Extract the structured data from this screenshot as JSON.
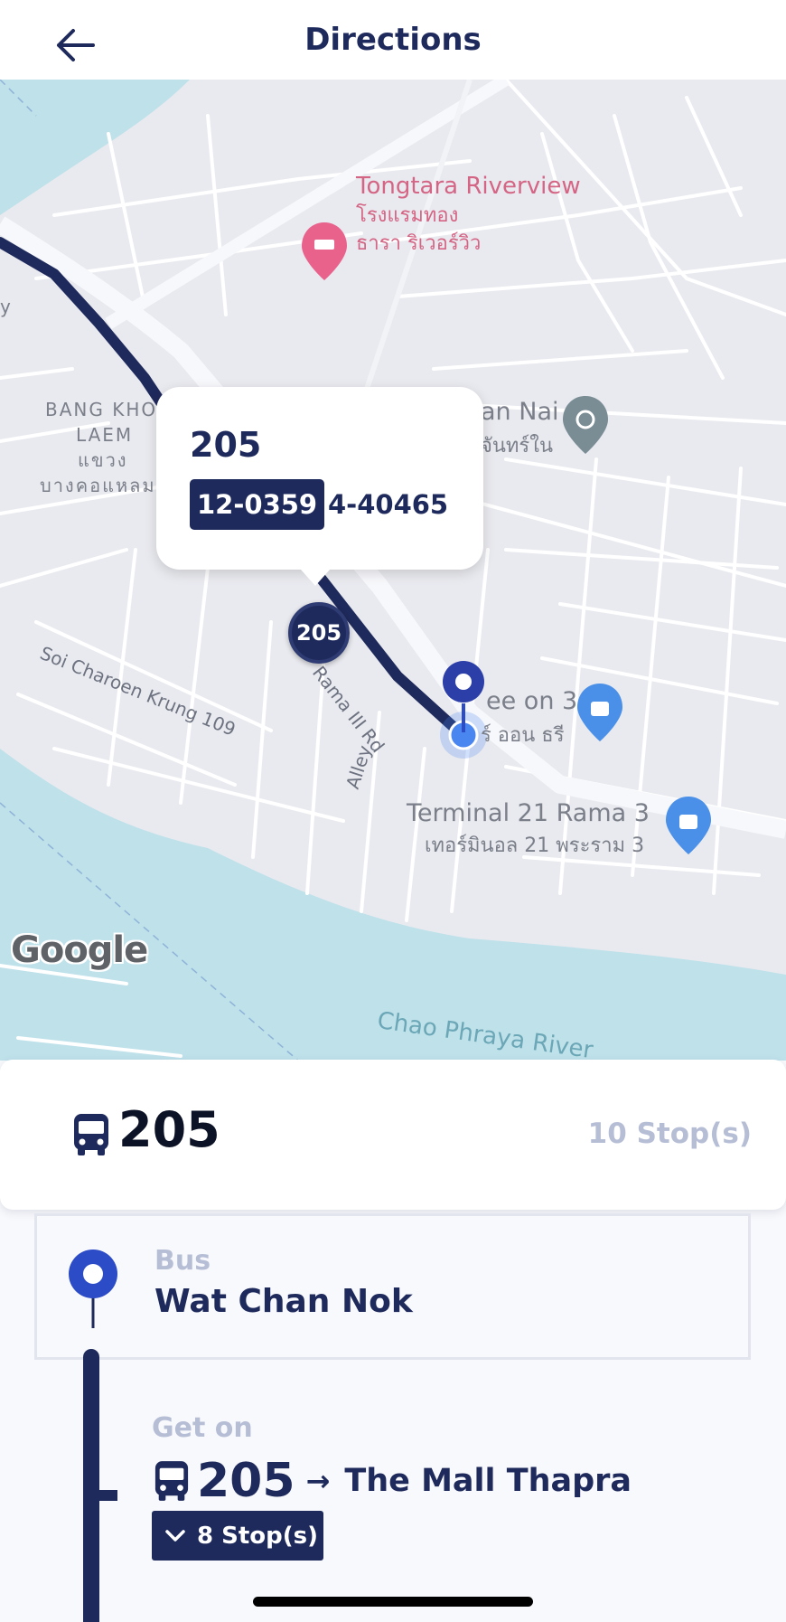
{
  "header": {
    "title": "Directions",
    "back_icon": "arrow-left-icon"
  },
  "map": {
    "labels": {
      "hotel_en": "Tongtara Riverview",
      "hotel_th1": "โรงแรมทอง",
      "hotel_th2": "ธารา ริเวอร์วิว",
      "area_en1": "BANG KHO",
      "area_en2": "LAEM",
      "area_th1": "แขวง",
      "area_th2": "บางคอแหลม",
      "temple_en": "an Nai",
      "temple_th": "จันทร์ใน",
      "road_soi": "Soi Charoen Krung 109",
      "road_rama": "Rama III Rd",
      "road_alley": "Alley",
      "shop_en": "ee on 3",
      "shop_th": "ร์ ออน ธรี",
      "mall_en": "Terminal 21 Rama 3",
      "mall_th": "เทอร์มินอล 21 พระราม 3",
      "river": "Chao Phraya River",
      "edge_y": "y",
      "google": "Google"
    },
    "colors": {
      "water": "#bfe1ea",
      "land": "#e9eaef",
      "road": "#ffffff",
      "route": "#1f2a5c",
      "pin_blue": "#2c4bc7",
      "current_location": "#4a86f0"
    },
    "callout": {
      "route": "205",
      "plate": "12-0359",
      "vehicle_id": "4-40465"
    },
    "bus_marker_label": "205"
  },
  "summary": {
    "route": "205",
    "stops": "10 Stop(s)",
    "icon": "bus-icon"
  },
  "steps": [
    {
      "type": "Bus",
      "name": "Wat Chan Nok",
      "icon": "location-pin-icon"
    },
    {
      "type": "Get on",
      "route": "205",
      "arrow": "→",
      "destination": "The Mall Thapra",
      "stops_toggle": "8 Stop(s)",
      "icon": "bus-icon"
    }
  ]
}
